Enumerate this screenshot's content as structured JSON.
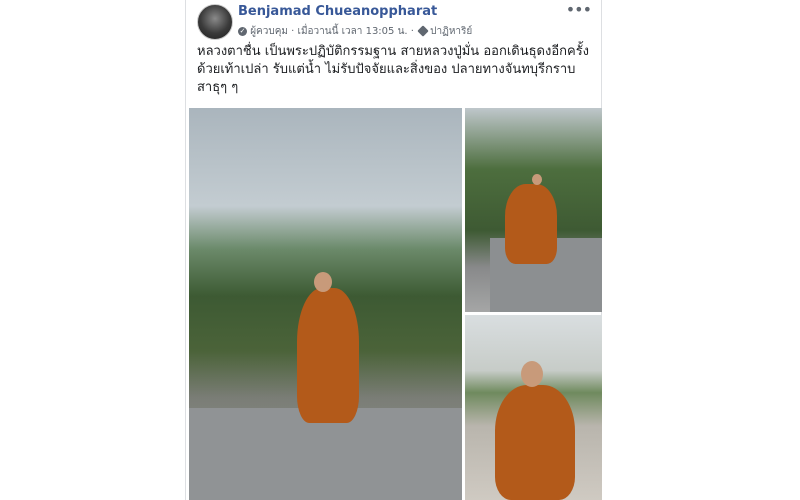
{
  "post": {
    "author": "Benjamad Chueanoppharat",
    "role": "ผู้ควบคุม",
    "time": "เมื่อวานนี้ เวลา 13:05 น.",
    "category": "ปาฏิหาริย์",
    "more_icon": "•••",
    "text": "หลวงตาชื่น เป็นพระปฏิบัติกรรมฐาน สายหลวงปู่มั่น ออกเดินธุดงอีกครั้ง ด้วยเท้าเปล่า รับแต่น้ำ ไม่รับปัจจัยและสิ่งของ ปลายทางจันทบุรีกราบสาธุๆ ๆ"
  }
}
